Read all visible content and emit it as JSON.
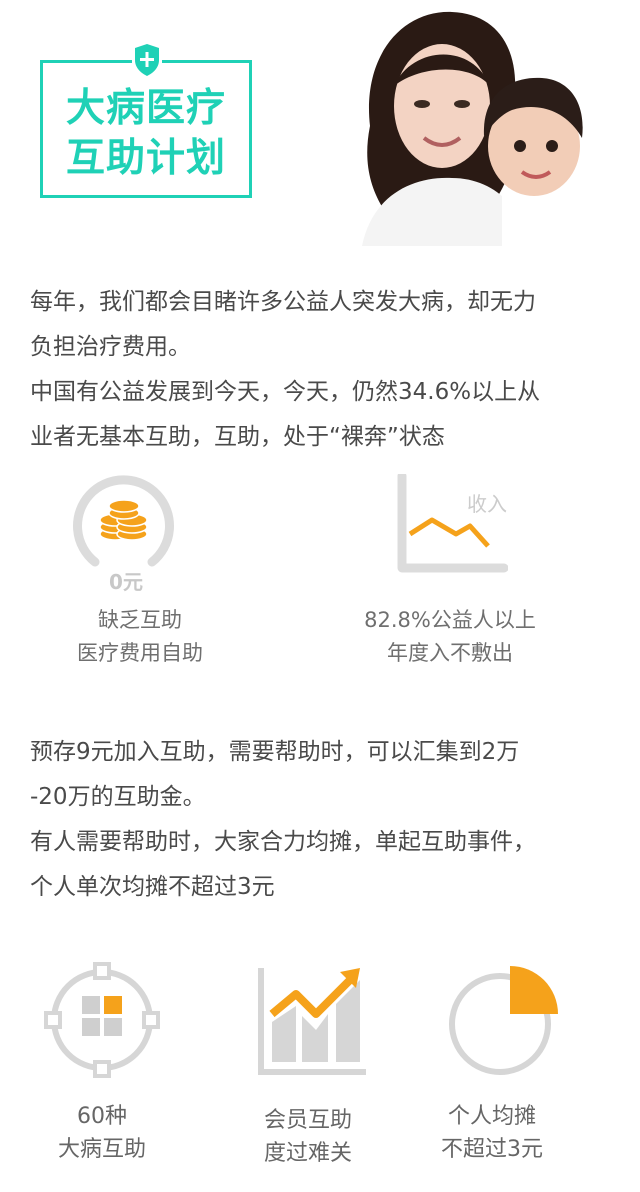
{
  "logo": {
    "line1": "大病医疗",
    "line2": "互助计划",
    "accent_color": "#1fd1b6",
    "icon": "shield-plus-icon"
  },
  "hero": {
    "icon": "mother-and-child-photo"
  },
  "intro": {
    "lines": [
      "每年，我们都会目睹许多公益人突发大病，却无力",
      "负担治疗费用。",
      "中国有公益发展到今天，今天，仍然34.6%以上从",
      "业者无基本互助，互助，处于“裸奔”状态"
    ]
  },
  "stats": [
    {
      "icon": "coins-gauge-icon",
      "badge": "0元",
      "line1": "缺乏互助",
      "line2": "医疗费用自助"
    },
    {
      "icon": "income-decline-chart-icon",
      "badge": "收入",
      "line1": "82.8%公益人以上",
      "line2": "年度入不敷出"
    }
  ],
  "plan": {
    "lines": [
      "预存9元加入互助，需要帮助时，可以汇集到2万",
      "-20万的互助金。",
      "有人需要帮助时，大家合力均摊，单起互助事件，",
      "个人单次均摊不超过3元"
    ]
  },
  "features": [
    {
      "icon": "target-grid-icon",
      "line1": "60种",
      "line2": "大病互助"
    },
    {
      "icon": "rising-bar-chart-icon",
      "line1": "会员互助",
      "line2": "度过难关"
    },
    {
      "icon": "pie-slice-icon",
      "line1": "个人均摊",
      "line2": "不超过3元"
    }
  ],
  "colors": {
    "orange": "#f5a21b",
    "gray": "#d8d8d8",
    "text": "#4a4a4a"
  }
}
